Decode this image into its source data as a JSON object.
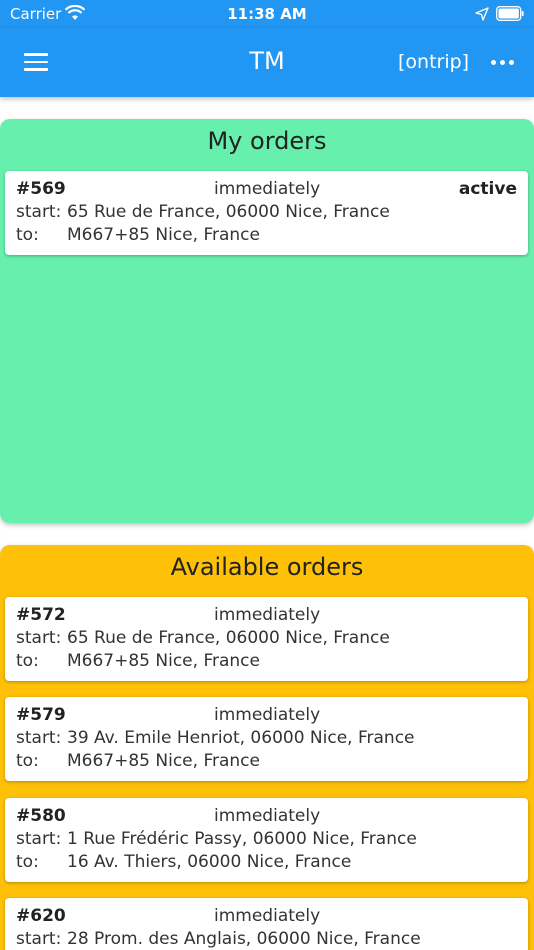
{
  "status_bar": {
    "carrier": "Carrier",
    "time": "11:38 AM"
  },
  "app_bar": {
    "title": "TM",
    "status": "[ontrip]",
    "color": "#2196f3"
  },
  "my_orders": {
    "title": "My orders",
    "color": "#67f0ad",
    "start_label": "start:",
    "to_label": "to:",
    "items": [
      {
        "id": "#569",
        "when": "immediately",
        "state": "active",
        "start": "65 Rue de France, 06000 Nice, France",
        "to": "M667+85 Nice, France"
      }
    ]
  },
  "available_orders": {
    "title": "Available orders",
    "color": "#ffc107",
    "start_label": "start:",
    "to_label": "to:",
    "items": [
      {
        "id": "#572",
        "when": "immediately",
        "start": "65 Rue de France, 06000 Nice, France",
        "to": "M667+85 Nice, France"
      },
      {
        "id": "#579",
        "when": "immediately",
        "start": "39 Av. Emile Henriot, 06000 Nice, France",
        "to": "M667+85 Nice, France"
      },
      {
        "id": "#580",
        "when": "immediately",
        "start": "1 Rue Frédéric Passy, 06000 Nice, France",
        "to": "16 Av. Thiers, 06000 Nice, France"
      },
      {
        "id": "#620",
        "when": "immediately",
        "start": "28 Prom. des Anglais, 06000 Nice, France",
        "to": ""
      }
    ]
  },
  "icons": {
    "menu": "menu-icon",
    "more": "more-horizontal-icon",
    "wifi": "wifi-icon",
    "location": "location-arrow-icon",
    "battery": "battery-icon"
  }
}
